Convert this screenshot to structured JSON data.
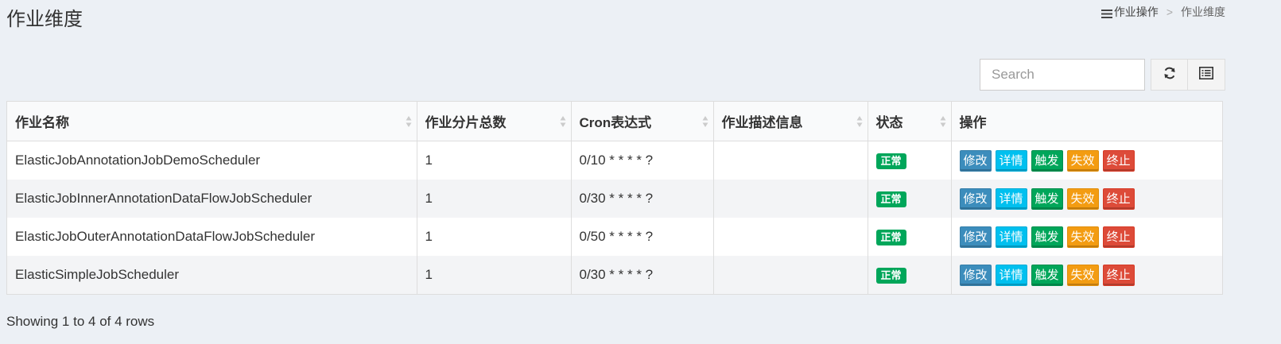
{
  "page": {
    "title": "作业维度",
    "breadcrumb": {
      "parent": "作业操作",
      "separator": ">",
      "current": "作业维度"
    }
  },
  "toolbar": {
    "search_placeholder": "Search",
    "refresh_icon": "refresh-icon",
    "columns_icon": "list-icon"
  },
  "table": {
    "columns": [
      "作业名称",
      "作业分片总数",
      "Cron表达式",
      "作业描述信息",
      "状态",
      "操作"
    ],
    "rows": [
      {
        "name": "ElasticJobAnnotationJobDemoScheduler",
        "shards": "1",
        "cron": "0/10 * * * * ?",
        "desc": "",
        "status": "正常"
      },
      {
        "name": "ElasticJobInnerAnnotationDataFlowJobScheduler",
        "shards": "1",
        "cron": "0/30 * * * * ?",
        "desc": "",
        "status": "正常"
      },
      {
        "name": "ElasticJobOuterAnnotationDataFlowJobScheduler",
        "shards": "1",
        "cron": "0/50 * * * * ?",
        "desc": "",
        "status": "正常"
      },
      {
        "name": "ElasticSimpleJobScheduler",
        "shards": "1",
        "cron": "0/30 * * * * ?",
        "desc": "",
        "status": "正常"
      }
    ],
    "actions": {
      "edit": "修改",
      "detail": "详情",
      "trigger": "触发",
      "disable": "失效",
      "stop": "终止"
    }
  },
  "footer": {
    "info": "Showing 1 to 4 of 4 rows"
  },
  "colors": {
    "background": "#ecf0f5",
    "status_ok": "#00a65a",
    "edit": "#3c8dbc",
    "detail": "#00c0ef",
    "trigger": "#00a65a",
    "disable": "#f39c12",
    "stop": "#dd4b39"
  }
}
